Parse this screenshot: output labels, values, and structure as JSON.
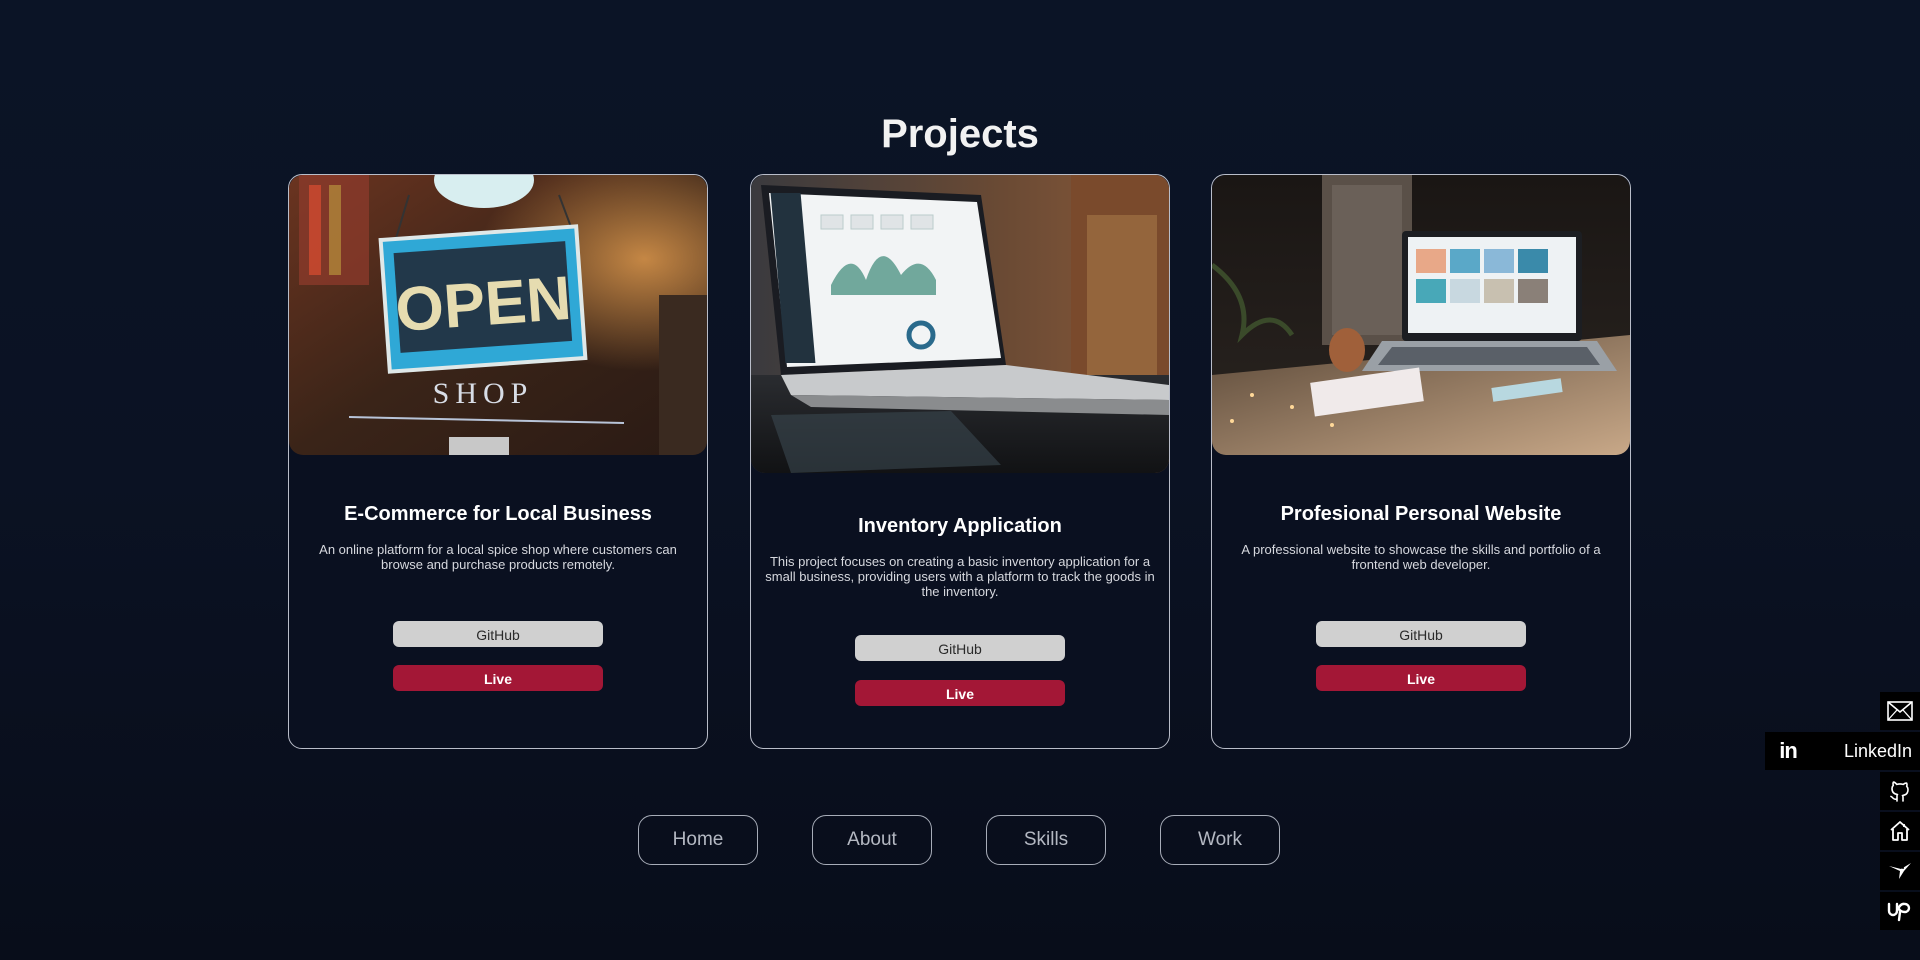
{
  "section": {
    "title": "Projects"
  },
  "projects": [
    {
      "title": "E-Commerce for Local Business",
      "description": "An online platform for a local spice shop where customers can browse and purchase products remotely.",
      "github_label": "GitHub",
      "live_label": "Live",
      "image_text_1": "OPEN",
      "image_text_2": "SHOP"
    },
    {
      "title": "Inventory Application",
      "description": "This project focuses on creating a basic inventory application for a small business, providing users with a platform to track the goods in the inventory.",
      "github_label": "GitHub",
      "live_label": "Live"
    },
    {
      "title": "Profesional Personal Website",
      "description": "A professional website to showcase the skills and portfolio of a frontend web developer.",
      "github_label": "GitHub",
      "live_label": "Live"
    }
  ],
  "nav": {
    "items": [
      {
        "label": "Home"
      },
      {
        "label": "About"
      },
      {
        "label": "Skills"
      },
      {
        "label": "Work"
      }
    ]
  },
  "social": {
    "linkedin_label": "LinkedIn",
    "icons": [
      "mail-icon",
      "linkedin-icon",
      "github-icon",
      "home-icon",
      "hummingbird-icon",
      "upwork-icon"
    ]
  },
  "colors": {
    "background": "#0b1426",
    "live_button": "#a31736",
    "github_button": "#d0d0d0",
    "card_border": "#b9bdc9"
  }
}
